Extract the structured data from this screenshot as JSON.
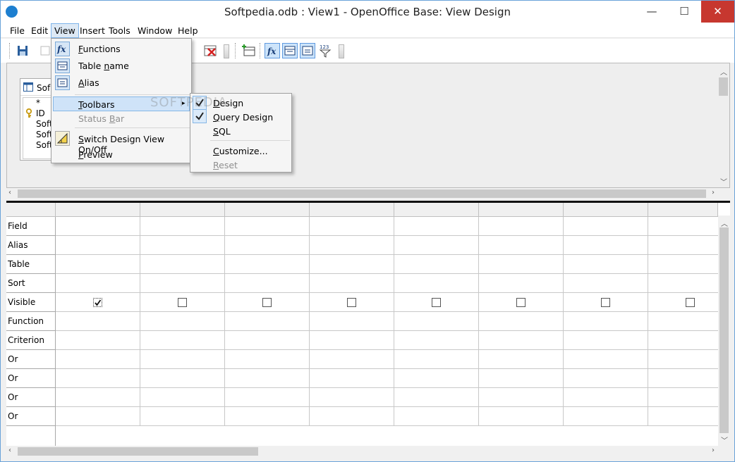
{
  "window": {
    "title": "Softpedia.odb : View1 - OpenOffice Base: View Design",
    "controls": {
      "minimize": "—",
      "maximize": "☐",
      "close": "✕"
    }
  },
  "menubar": {
    "items": [
      "File",
      "Edit",
      "View",
      "Insert",
      "Tools",
      "Window",
      "Help"
    ]
  },
  "table_window": {
    "title": "Sof",
    "fields": [
      "*",
      "ID",
      "Soft",
      "Soft",
      "Soft"
    ]
  },
  "view_menu": {
    "items": [
      {
        "label": "Functions",
        "icon": "functions-icon",
        "checked": true
      },
      {
        "label": "Table name",
        "icon": "table-name-icon",
        "checked": true
      },
      {
        "label": "Alias",
        "icon": "alias-icon",
        "checked": true
      },
      {
        "label": "Toolbars",
        "submenu": true,
        "highlighted": true
      },
      {
        "label": "Status Bar",
        "disabled": true
      },
      {
        "label": "Switch Design View On/Off",
        "icon": "switch-design-icon"
      },
      {
        "label": "Preview"
      }
    ]
  },
  "toolbars_submenu": {
    "items": [
      {
        "label": "Design",
        "checked": true
      },
      {
        "label": "Query Design",
        "checked": true
      },
      {
        "label": "SQL",
        "checked": false
      },
      {
        "label": "Customize...",
        "checked": false
      },
      {
        "label": "Reset",
        "disabled": true
      }
    ]
  },
  "watermark": "SOFTPEDIA",
  "grid": {
    "row_labels": [
      "Field",
      "Alias",
      "Table",
      "Sort",
      "Visible",
      "Function",
      "Criterion",
      "Or",
      "Or",
      "Or",
      "Or"
    ],
    "columns": 8,
    "visible_checked": [
      true,
      false,
      false,
      false,
      false,
      false,
      false,
      false
    ]
  }
}
